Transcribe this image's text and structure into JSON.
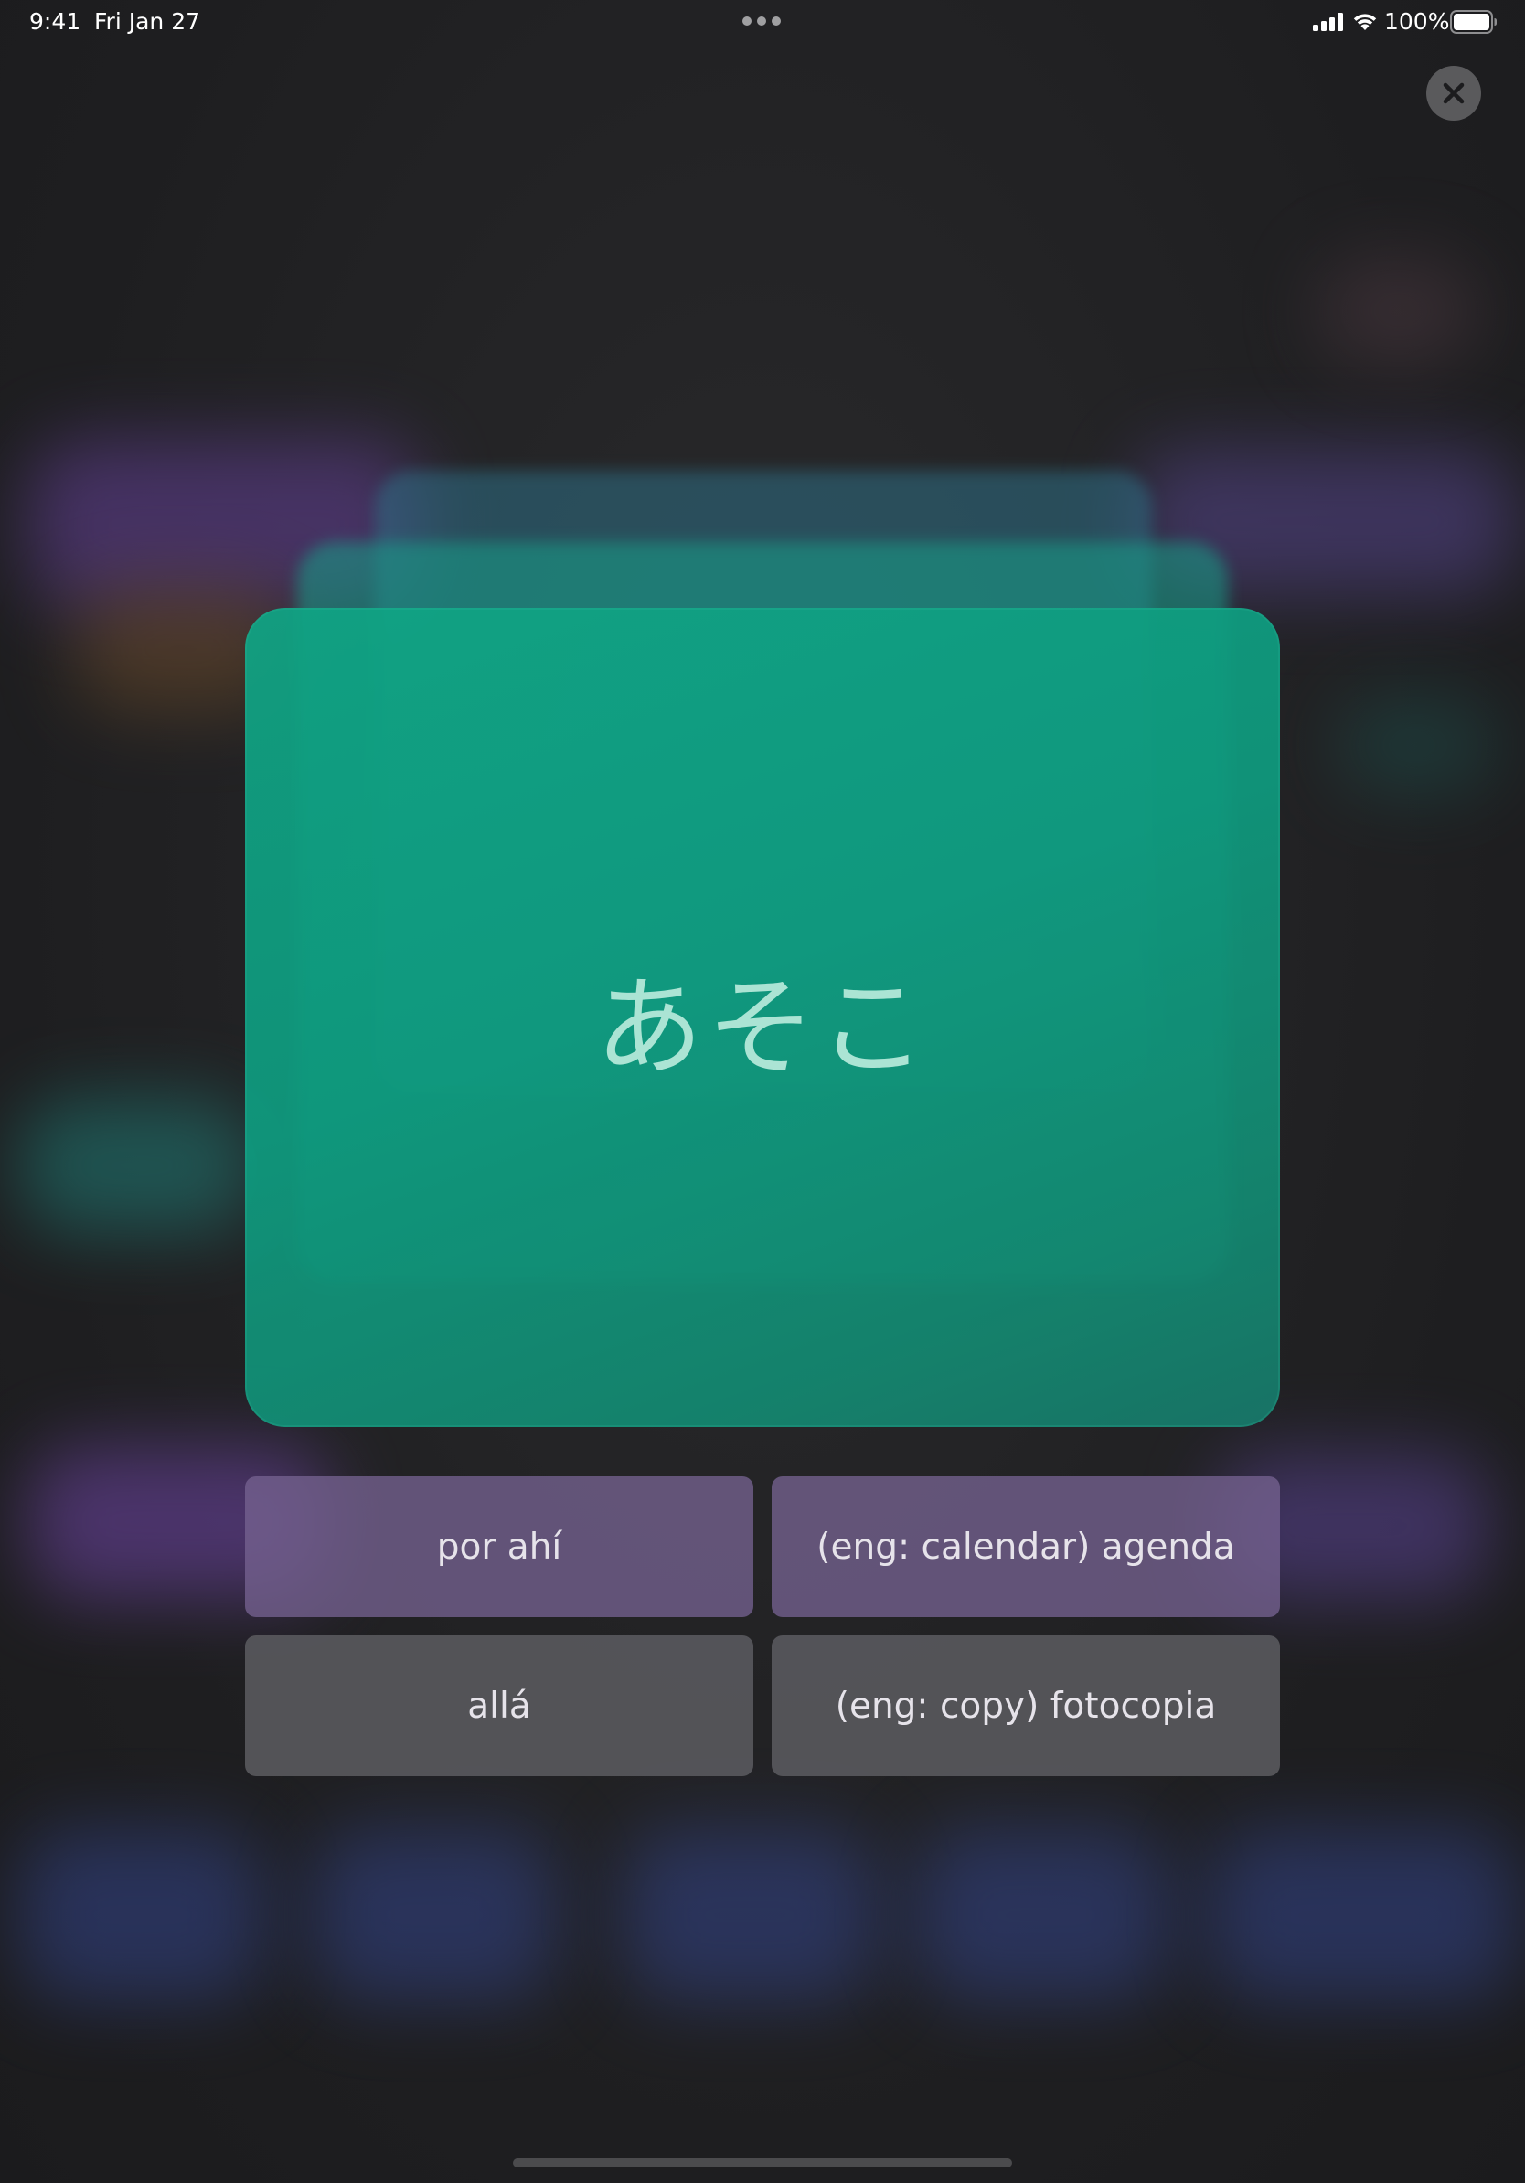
{
  "status_bar": {
    "time": "9:41",
    "date": "Fri Jan 27",
    "battery_percent": "100%",
    "signal_icon": "cellular-signal-icon",
    "wifi_icon": "wifi-icon",
    "battery_icon": "battery-icon",
    "multitasking_icon": "ellipsis-icon"
  },
  "close_button": {
    "icon": "close-icon"
  },
  "flash_card": {
    "word": "あそこ"
  },
  "answers": [
    {
      "label": "por ahí"
    },
    {
      "label": "(eng: calendar) agenda"
    },
    {
      "label": "allá"
    },
    {
      "label": "(eng: copy) fotocopia"
    }
  ],
  "colors": {
    "card_accent": "#0f9b7f",
    "card_text": "#b6ecdc",
    "answer_purple": "#746290",
    "answer_gray": "#58585c"
  }
}
